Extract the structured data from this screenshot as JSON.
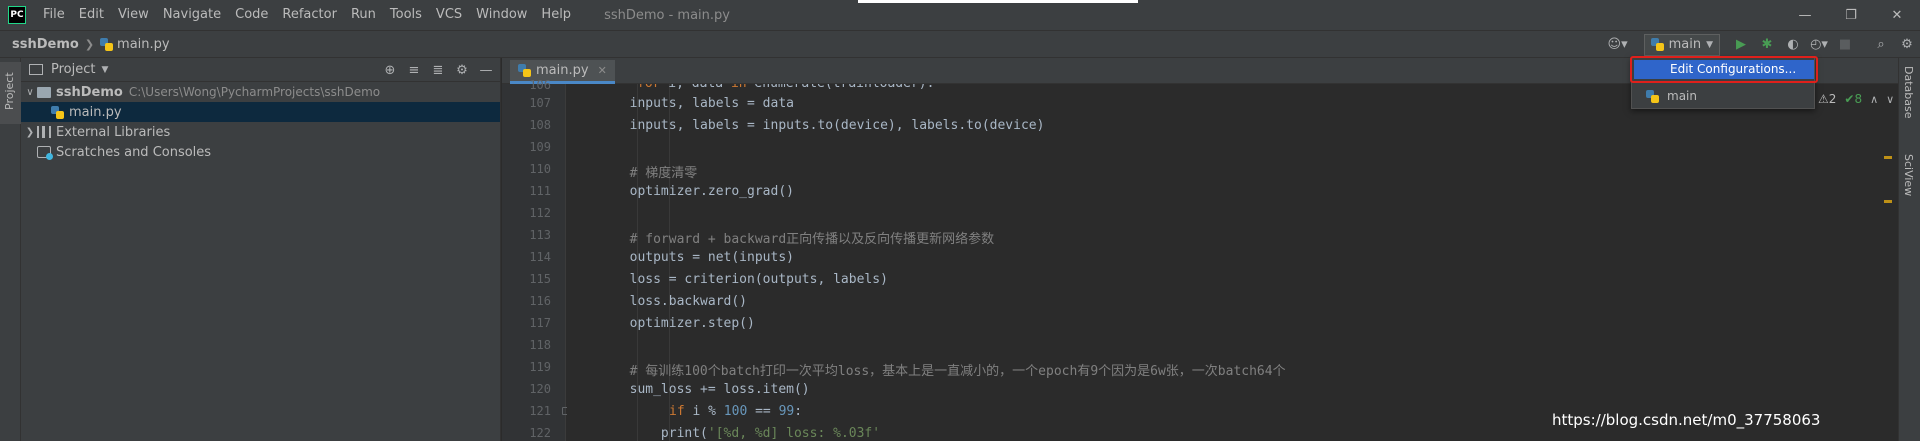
{
  "window": {
    "title": "sshDemo - main.py",
    "menu": [
      "File",
      "Edit",
      "View",
      "Navigate",
      "Code",
      "Refactor",
      "Run",
      "Tools",
      "VCS",
      "Window",
      "Help"
    ],
    "logo_text": "PC",
    "controls": [
      "—",
      "❐",
      "✕"
    ]
  },
  "navbar": {
    "project": "sshDemo",
    "separator": "❯",
    "file": "main.py",
    "run_config": "main",
    "user_icon": "☺▾",
    "run_icon": "▶",
    "debug_icon": "✱",
    "coverage_icon": "◐",
    "profile_icon": "◴▾",
    "stop_icon": "■",
    "search_icon": "⌕",
    "settings_icon": "⚙"
  },
  "left_stripe": {
    "project_label": "Project"
  },
  "project_panel": {
    "title": "Project",
    "dropdown": "▼",
    "tools": [
      "⊕",
      "≡",
      "≣",
      "⚙",
      "—"
    ],
    "tree": [
      {
        "arrow": "∨",
        "name": "sshDemo",
        "path": "C:\\Users\\Wong\\PycharmProjects\\sshDemo"
      },
      {
        "name": "main.py"
      },
      {
        "arrow": "❯",
        "name": "External Libraries"
      },
      {
        "name": "Scratches and Consoles"
      }
    ]
  },
  "editor": {
    "tab_label": "main.py",
    "tab_close": "✕",
    "line_numbers": [
      "107",
      "108",
      "109",
      "110",
      "111",
      "112",
      "113",
      "114",
      "115",
      "116",
      "117",
      "118",
      "119",
      "120",
      "121",
      "122"
    ],
    "lines": {
      "l106": "for i, data in enumerate(trainloader):",
      "l107": "        inputs, labels = data",
      "l108": "        inputs, labels = inputs.to(device), labels.to(device)",
      "l110": "        # 梯度清零",
      "l111": "        optimizer.zero_grad()",
      "l113": "        # forward + backward正向传播以及反向传播更新网络参数",
      "l114": "        outputs = net(inputs)",
      "l115": "        loss = criterion(outputs, labels)",
      "l116": "        loss.backward()",
      "l117": "        optimizer.step()",
      "l119": "        # 每训练100个batch打印一次平均loss，基本上是一直减小的，一个epoch有9个因为是6w张，一次batch64个",
      "l120": "        sum_loss += loss.item()",
      "l121_kw": "if",
      "l121_a": " i % ",
      "l121_num": "100",
      "l121_b": " == ",
      "l121_num2": "99",
      "l121_c": ":",
      "l122_a": "            print(",
      "l122_str": "'[%d, %d] loss: %.03f'"
    },
    "markers": {
      "warn": "⚠2",
      "ok": "✔8",
      "up": "∧",
      "down": "∨"
    }
  },
  "right_stripe": {
    "labels": [
      "Database",
      "SciView"
    ]
  },
  "popup": {
    "edit_config": "Edit Configurations...",
    "main": "main"
  },
  "watermark": "https://blog.csdn.net/m0_37758063"
}
